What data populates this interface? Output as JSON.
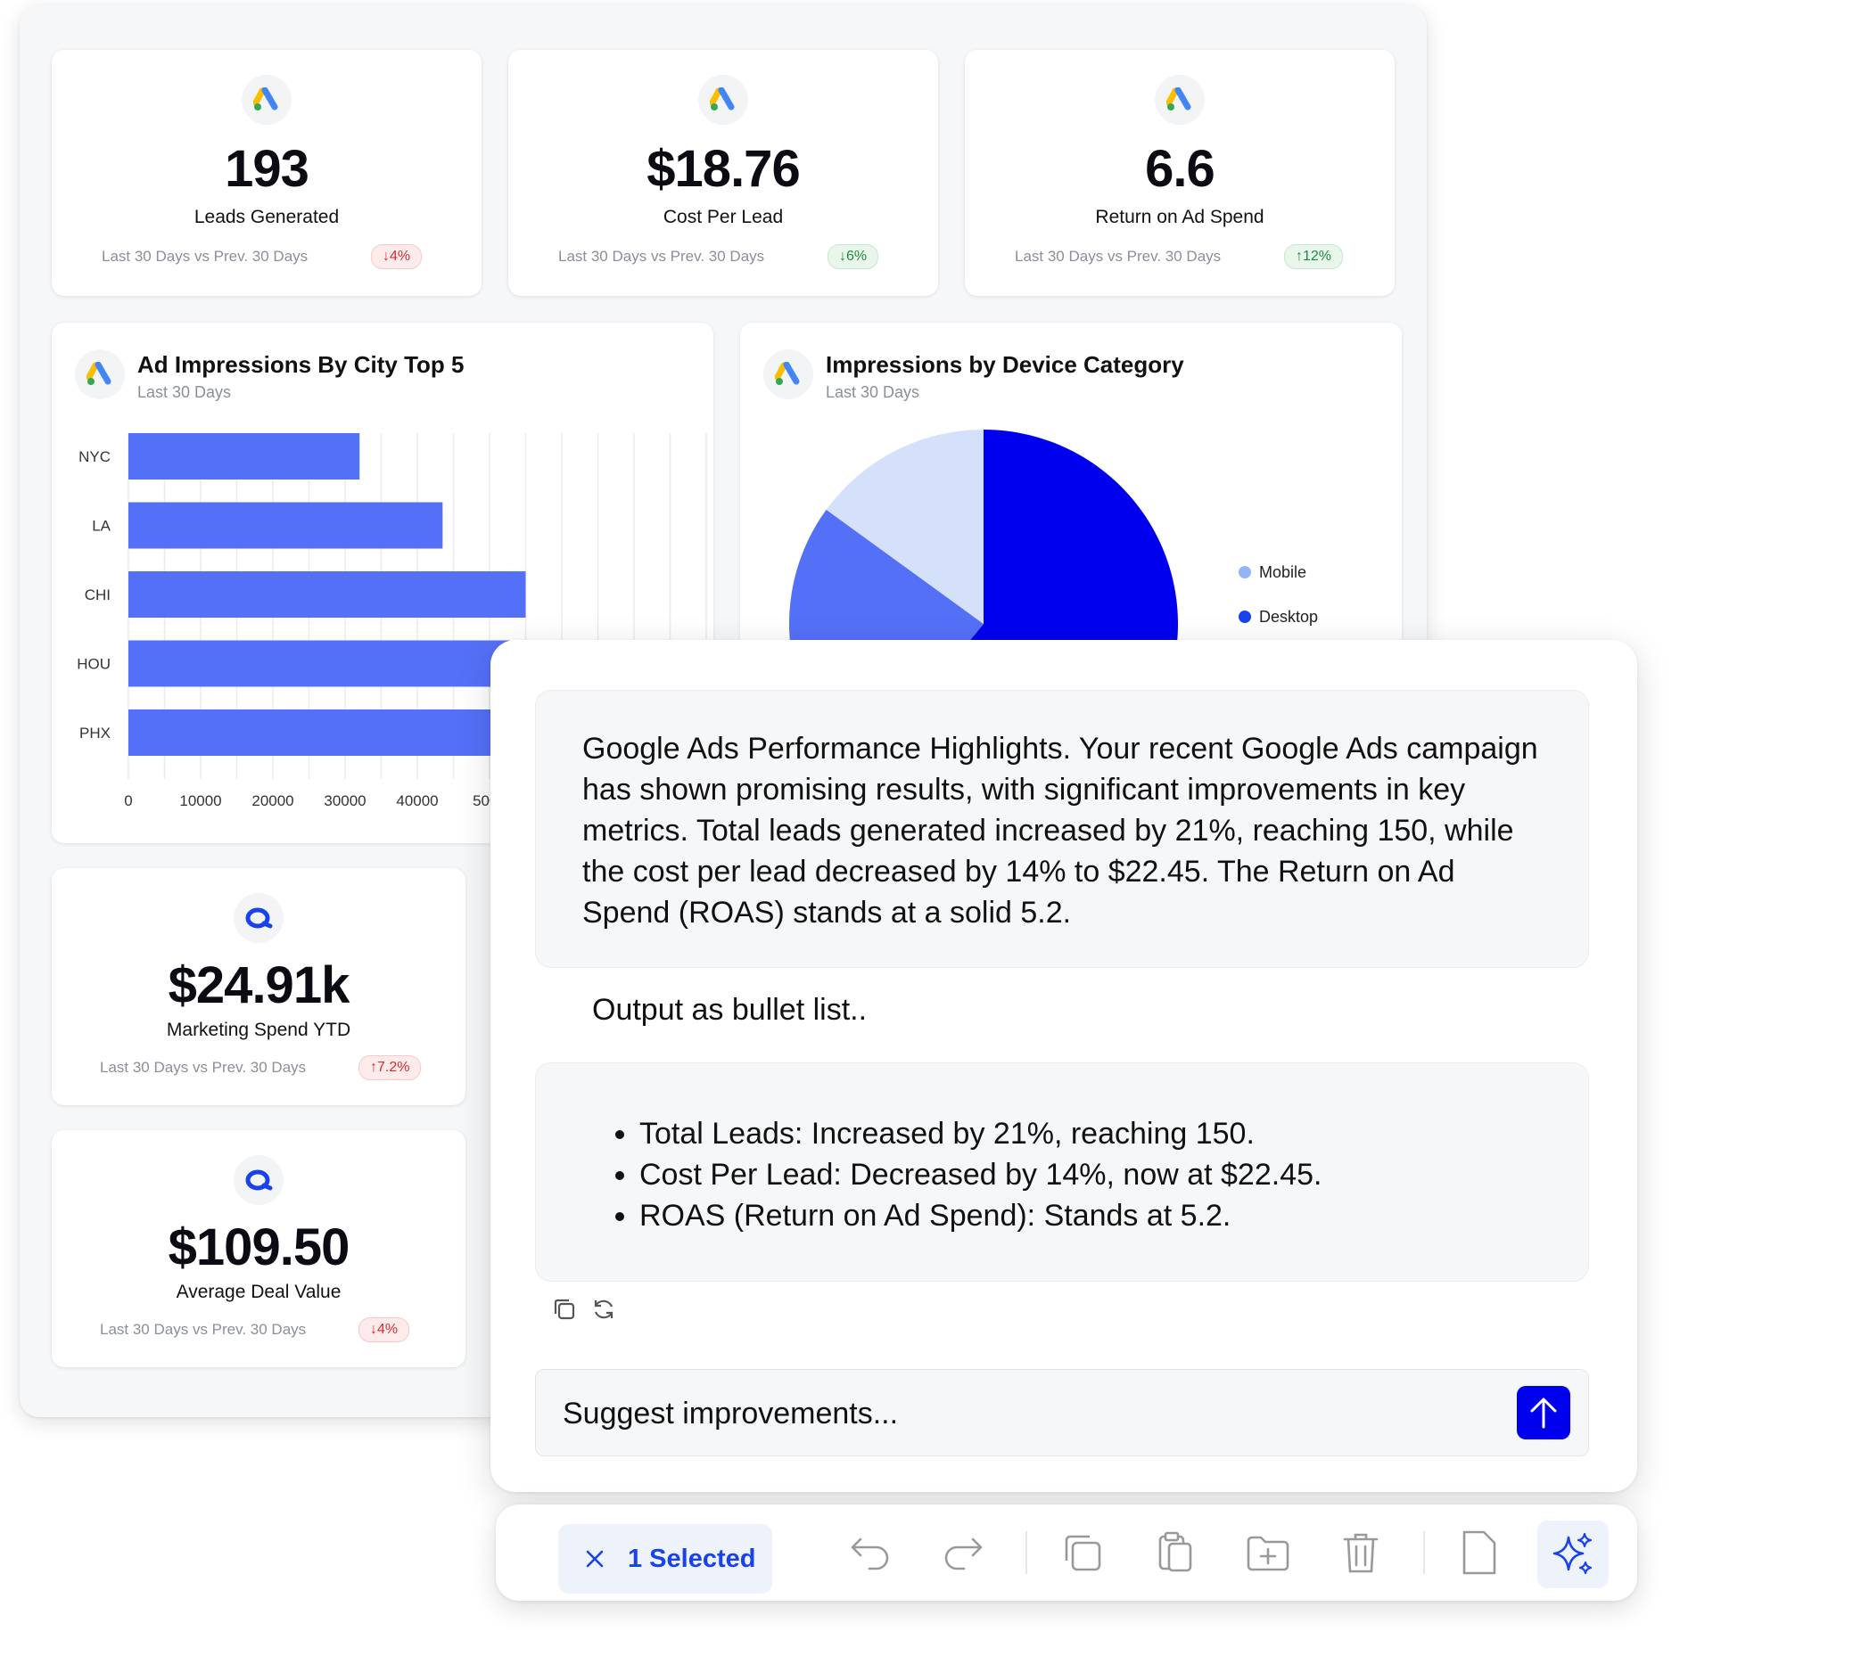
{
  "kpis": [
    {
      "value": "193",
      "label": "Leads Generated",
      "compare": "Last 30 Days vs Prev. 30 Days",
      "change": "↓4%",
      "direction": "down"
    },
    {
      "value": "$18.76",
      "label": "Cost Per Lead",
      "compare": "Last 30 Days vs Prev. 30 Days",
      "change": "↓6%",
      "direction": "up"
    },
    {
      "value": "6.6",
      "label": "Return on Ad Spend",
      "compare": "Last 30 Days vs Prev. 30 Days",
      "change": "↑12%",
      "direction": "up"
    },
    {
      "value": "$24.91k",
      "label": "Marketing Spend YTD",
      "compare": "Last 30 Days vs Prev. 30 Days",
      "change": "↑7.2%",
      "direction": "down"
    },
    {
      "value": "$109.50",
      "label": "Average Deal Value",
      "compare": "Last 30 Days vs Prev. 30 Days",
      "change": "↓4%",
      "direction": "down"
    }
  ],
  "bar_panel": {
    "title": "Ad Impressions By City Top 5",
    "subtitle": "Last 30 Days"
  },
  "pie_panel": {
    "title": "Impressions by Device Category",
    "subtitle": "Last 30 Days"
  },
  "chart_data": [
    {
      "type": "bar",
      "orientation": "horizontal",
      "categories": [
        "NYC",
        "LA",
        "CHI",
        "HOU",
        "PHX"
      ],
      "values": [
        32000,
        43500,
        55000,
        53000,
        51000
      ],
      "x_ticks": [
        "0",
        "10000",
        "20000",
        "30000",
        "40000",
        "5000"
      ],
      "xlim": [
        0,
        80000
      ],
      "grid": true,
      "bar_color": "#5470f7"
    },
    {
      "type": "pie",
      "series": [
        {
          "name": "Desktop",
          "value": 61,
          "color": "#0000ee"
        },
        {
          "name": "",
          "value": 24,
          "color": "#5470f7"
        },
        {
          "name": "Mobile",
          "value": 15,
          "color": "#d5e0fb"
        }
      ],
      "legend_labels": [
        "Mobile",
        "Desktop"
      ],
      "legend_colors": [
        "#93b4f7",
        "#1742ee"
      ],
      "legend_position": "right"
    }
  ],
  "chat": {
    "response_1": "Google Ads Performance Highlights. Your recent Google Ads campaign has shown promising results, with significant improvements in key metrics. Total leads generated increased by 21%, reaching 150, while the cost per lead decreased by 14% to $22.45. The Return on Ad Spend (ROAS) stands at a solid 5.2.",
    "user_prompt": "Output as bullet list..",
    "bullets": [
      "Total Leads: Increased by 21%, reaching 150.",
      "Cost Per Lead: Decreased by 14%, now at $22.45.",
      "ROAS (Return on Ad Spend): Stands at 5.2."
    ],
    "input_placeholder": "Suggest improvements...",
    "send_color": "#0000ee"
  },
  "toolbar": {
    "selected_label": "1 Selected",
    "icons": [
      "close-icon",
      "undo-icon",
      "redo-icon",
      "copy-icon",
      "paste-icon",
      "add-folder-icon",
      "trash-icon",
      "page-icon",
      "sparkles-icon"
    ]
  },
  "colors": {
    "accent": "#1742ee",
    "bar": "#5470f7",
    "badge_down": "#d32f2f",
    "badge_up": "#218a3d"
  }
}
